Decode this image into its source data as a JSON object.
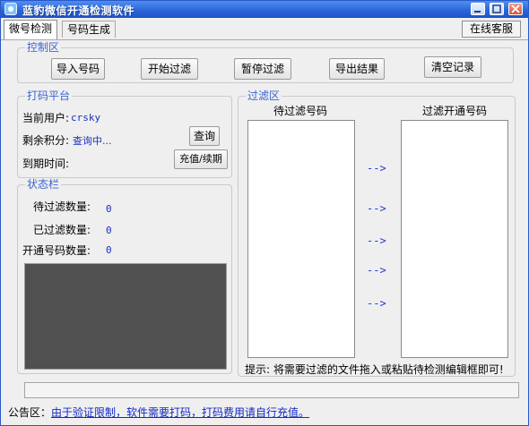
{
  "window": {
    "title": "蓝豹微信开通检测软件",
    "controls": {
      "minimize": "minimize-icon",
      "maximize": "maximize-icon",
      "close": "close-icon"
    }
  },
  "tabs": [
    {
      "label": "微号检测",
      "active": true
    },
    {
      "label": "号码生成",
      "active": false
    }
  ],
  "online_service": "在线客服",
  "control_panel": {
    "legend": "控制区",
    "buttons": [
      "导入号码",
      "开始过滤",
      "暂停过滤",
      "导出结果",
      "清空记录"
    ]
  },
  "platform": {
    "legend": "打码平台",
    "current_user_label": "当前用户:",
    "current_user_value": "crsky",
    "points_label": "剩余积分:",
    "points_value": "查询中...",
    "query_button": "查询",
    "expiry_label": "到期时间:",
    "recharge_button": "充值/续期"
  },
  "status": {
    "legend": "状态栏",
    "pending_label": "待过滤数量:",
    "pending_value": "0",
    "filtered_label": "已过滤数量:",
    "filtered_value": "0",
    "opened_label": "开通号码数量:",
    "opened_value": "0"
  },
  "filter_area": {
    "legend": "过滤区",
    "pending_header": "待过滤号码",
    "opened_header": "过滤开通号码",
    "arrow": "-->",
    "hint": "提示: 将需要过滤的文件拖入或粘贴待检测编辑框即可!"
  },
  "notice": {
    "label": "公告区：",
    "text": "由于验证限制，软件需要打码，打码费用请自行充值。"
  },
  "colors": {
    "accent": "#3c64d0",
    "titlebar": "#2a63d8",
    "value_text": "#1a2fbf"
  }
}
